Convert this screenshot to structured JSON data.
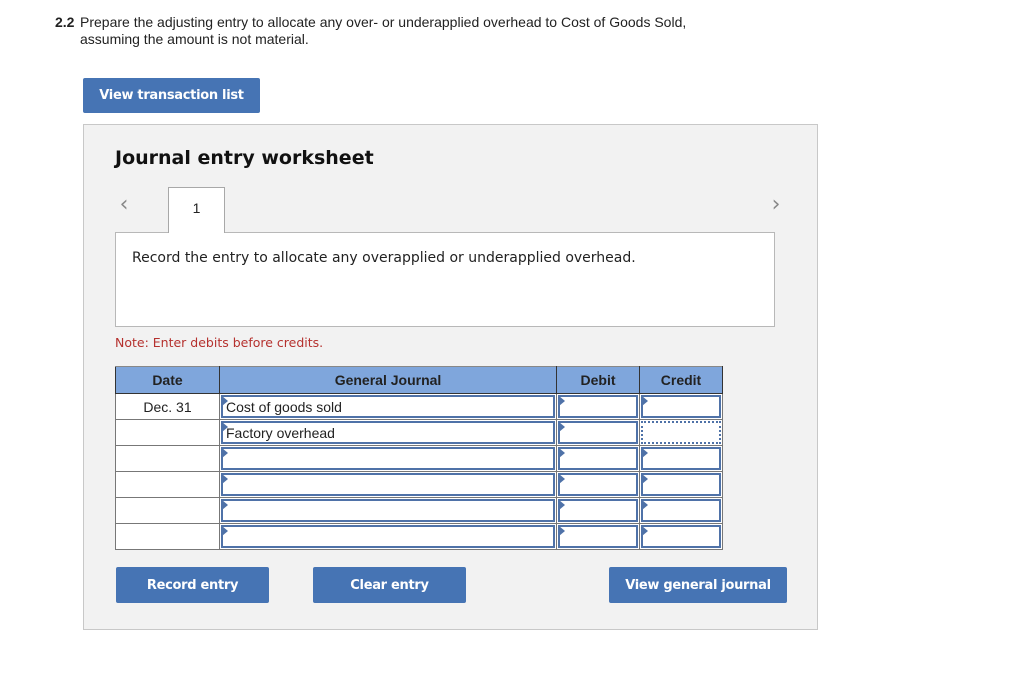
{
  "question": {
    "number": "2.2",
    "text_line1": "Prepare the adjusting entry to allocate any over- or underapplied overhead to Cost of Goods Sold,",
    "text_line2": "assuming the amount is not material."
  },
  "buttons": {
    "view_transaction_list": "View transaction list",
    "record_entry": "Record entry",
    "clear_entry": "Clear entry",
    "view_general_journal": "View general journal"
  },
  "worksheet": {
    "title": "Journal entry worksheet",
    "prev_icon": "‹",
    "next_icon": "›",
    "tabs": [
      {
        "label": "1"
      }
    ],
    "instruction": "Record the entry to allocate any overapplied or underapplied overhead.",
    "note": "Note: Enter debits before credits."
  },
  "journal": {
    "headers": {
      "date": "Date",
      "general_journal": "General Journal",
      "debit": "Debit",
      "credit": "Credit"
    },
    "rows": [
      {
        "date": "Dec. 31",
        "account": "Cost of goods sold",
        "debit": "",
        "credit": ""
      },
      {
        "date": "",
        "account": "Factory overhead",
        "debit": "",
        "credit": ""
      },
      {
        "date": "",
        "account": "",
        "debit": "",
        "credit": ""
      },
      {
        "date": "",
        "account": "",
        "debit": "",
        "credit": ""
      },
      {
        "date": "",
        "account": "",
        "debit": "",
        "credit": ""
      },
      {
        "date": "",
        "account": "",
        "debit": "",
        "credit": ""
      }
    ]
  },
  "colors": {
    "button_blue": "#4674b4",
    "header_blue": "#7fa6dc",
    "note_red": "#b5312e",
    "input_border": "#4f72a8"
  }
}
